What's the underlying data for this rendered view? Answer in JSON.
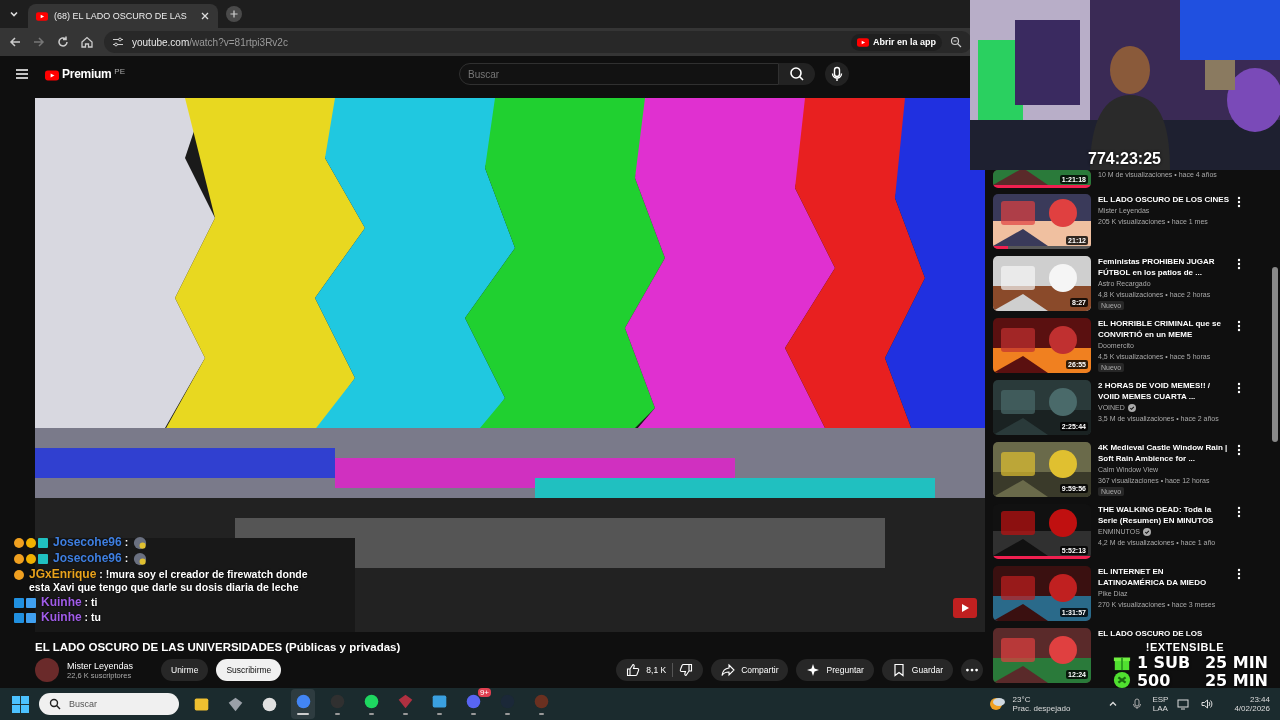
{
  "browser": {
    "tab": {
      "title": "(68) EL LADO OSCURO DE LAS",
      "selected": true
    },
    "address": {
      "host": "youtube.com",
      "path": "/watch?v=81rtpi3Rv2c"
    },
    "open_app": "Abrir en la app"
  },
  "header": {
    "logo": "Premium",
    "region": "PE",
    "search": {
      "placeholder": "Buscar"
    }
  },
  "video": {
    "title": "EL LADO OSCURO DE LAS UNIVERSIDADES (Públicas y privadas)",
    "channel": "Mister Leyendas",
    "subscribers": "22,6 K suscriptores",
    "join": "Unirme",
    "subscribe": "Suscribirme",
    "likes": "8,1 K",
    "actions": [
      {
        "kind": "share",
        "label": "Compartir"
      },
      {
        "kind": "ask",
        "label": "Preguntar"
      },
      {
        "kind": "save",
        "label": "Guardar"
      }
    ]
  },
  "recommended": [
    {
      "kind": "partial",
      "meta": "10 M de visualizaciones • hace 4 años",
      "duration": "1:21:18",
      "level": 1
    },
    {
      "kind": "full",
      "title": "EL LADO OSCURO DE LOS CINES",
      "channel": "Mister Leyendas",
      "verified": false,
      "meta": "205 K visualizaciones • hace 1 mes",
      "duration": "21:12",
      "level": 0.15
    },
    {
      "kind": "full",
      "title": "Feministas PROHIBEN JUGAR FÚTBOL en los patios de ...",
      "channel": "Astro Recargado",
      "verified": false,
      "meta": "4,8 K visualizaciones • hace 2 horas",
      "badge": "Nuevo",
      "duration": "8:27"
    },
    {
      "kind": "full",
      "title": "EL HORRIBLE CRIMINAL que se CONVIRTIÓ en un MEME",
      "channel": "Doomercito",
      "verified": false,
      "meta": "4,5 K visualizaciones • hace 5 horas",
      "badge": "Nuevo",
      "duration": "26:55"
    },
    {
      "kind": "full",
      "title": "2 HORAS DE VOID MEMES!! / VOIID MEMES CUARTA ...",
      "channel": "VOINED",
      "verified": true,
      "meta": "3,5 M de visualizaciones • hace 2 años",
      "duration": "2:25:44"
    },
    {
      "kind": "full",
      "title": "4K Medieval Castle Window Rain | Soft Rain Ambience for ...",
      "channel": "Calm Window View",
      "verified": false,
      "meta": "367 visualizaciones • hace 12 horas",
      "badge": "Nuevo",
      "duration": "9:59:56"
    },
    {
      "kind": "full",
      "title": "THE WALKING DEAD: Toda la Serie (Resumen) EN MINUTOS",
      "channel": "ENMINUTOS",
      "verified": true,
      "meta": "4,2 M de visualizaciones • hace 1 año",
      "duration": "5:52:13",
      "level": 1
    },
    {
      "kind": "full",
      "title": "EL INTERNET EN LATINOAMÉRICA DA MIEDO",
      "channel": "Pike Diaz",
      "verified": false,
      "meta": "270 K visualizaciones • hace 3 meses",
      "duration": "1:31:57"
    },
    {
      "kind": "cut",
      "title": "EL LADO OSCURO DE LOS",
      "duration": "12:24"
    }
  ],
  "stream": {
    "timer": "774:23:25",
    "command": "!EXTENSIBLE",
    "rules": [
      {
        "kind": "gift",
        "amount": "1 SUB",
        "time": "25 MIN"
      },
      {
        "kind": "bits",
        "amount": "500",
        "time": "25 MIN"
      }
    ]
  },
  "chat": [
    {
      "user": "Josecohe96",
      "color": "#3f7fe0",
      "badges": [
        {
          "kind": "crown"
        },
        {
          "kind": "sub"
        },
        {
          "kind": "grid"
        }
      ],
      "message": ":",
      "emote": true
    },
    {
      "user": "Josecohe96",
      "color": "#3f7fe0",
      "badges": [
        {
          "kind": "crown"
        },
        {
          "kind": "sub"
        },
        {
          "kind": "grid"
        }
      ],
      "message": ":",
      "emote": true
    },
    {
      "user": "JGxEnrique",
      "color": "#e8a21c",
      "badges": [
        {
          "kind": "crown"
        }
      ],
      "message": ": !mura soy el creador de firewatch donde esta Xavi que tengo que darle su dosis diaria de leche",
      "emote": false
    },
    {
      "user": "Kuinhe",
      "color": "#a05ce8",
      "badges": [
        {
          "kind": "hammer"
        },
        {
          "kind": "cube"
        }
      ],
      "message": ": ti",
      "emote": false
    },
    {
      "user": "Kuinhe",
      "color": "#a05ce8",
      "badges": [
        {
          "kind": "hammer"
        },
        {
          "kind": "cube"
        }
      ],
      "message": ": tu",
      "emote": false
    }
  ],
  "taskbar": {
    "search": {
      "placeholder": "Buscar"
    },
    "apps": [
      {
        "kind": "folder",
        "running": false,
        "active": false
      },
      {
        "kind": "prism",
        "running": false,
        "active": false
      },
      {
        "kind": "ring",
        "running": false,
        "active": false
      },
      {
        "kind": "browser",
        "running": true,
        "active": true
      },
      {
        "kind": "record",
        "running": true,
        "active": false
      },
      {
        "kind": "music",
        "running": true,
        "active": false
      },
      {
        "kind": "mask",
        "running": true,
        "active": false
      },
      {
        "kind": "notes",
        "running": true,
        "active": false
      },
      {
        "kind": "chat",
        "running": true,
        "active": false,
        "badge": "9+"
      },
      {
        "kind": "steam",
        "running": true,
        "active": false
      },
      {
        "kind": "game",
        "running": true,
        "active": false
      }
    ],
    "weather": {
      "temp": "23°C",
      "sky": "Prac. despejado"
    },
    "lang": [
      "ESP",
      "LAA"
    ],
    "time": "23:44",
    "date": "4/02/2026"
  }
}
